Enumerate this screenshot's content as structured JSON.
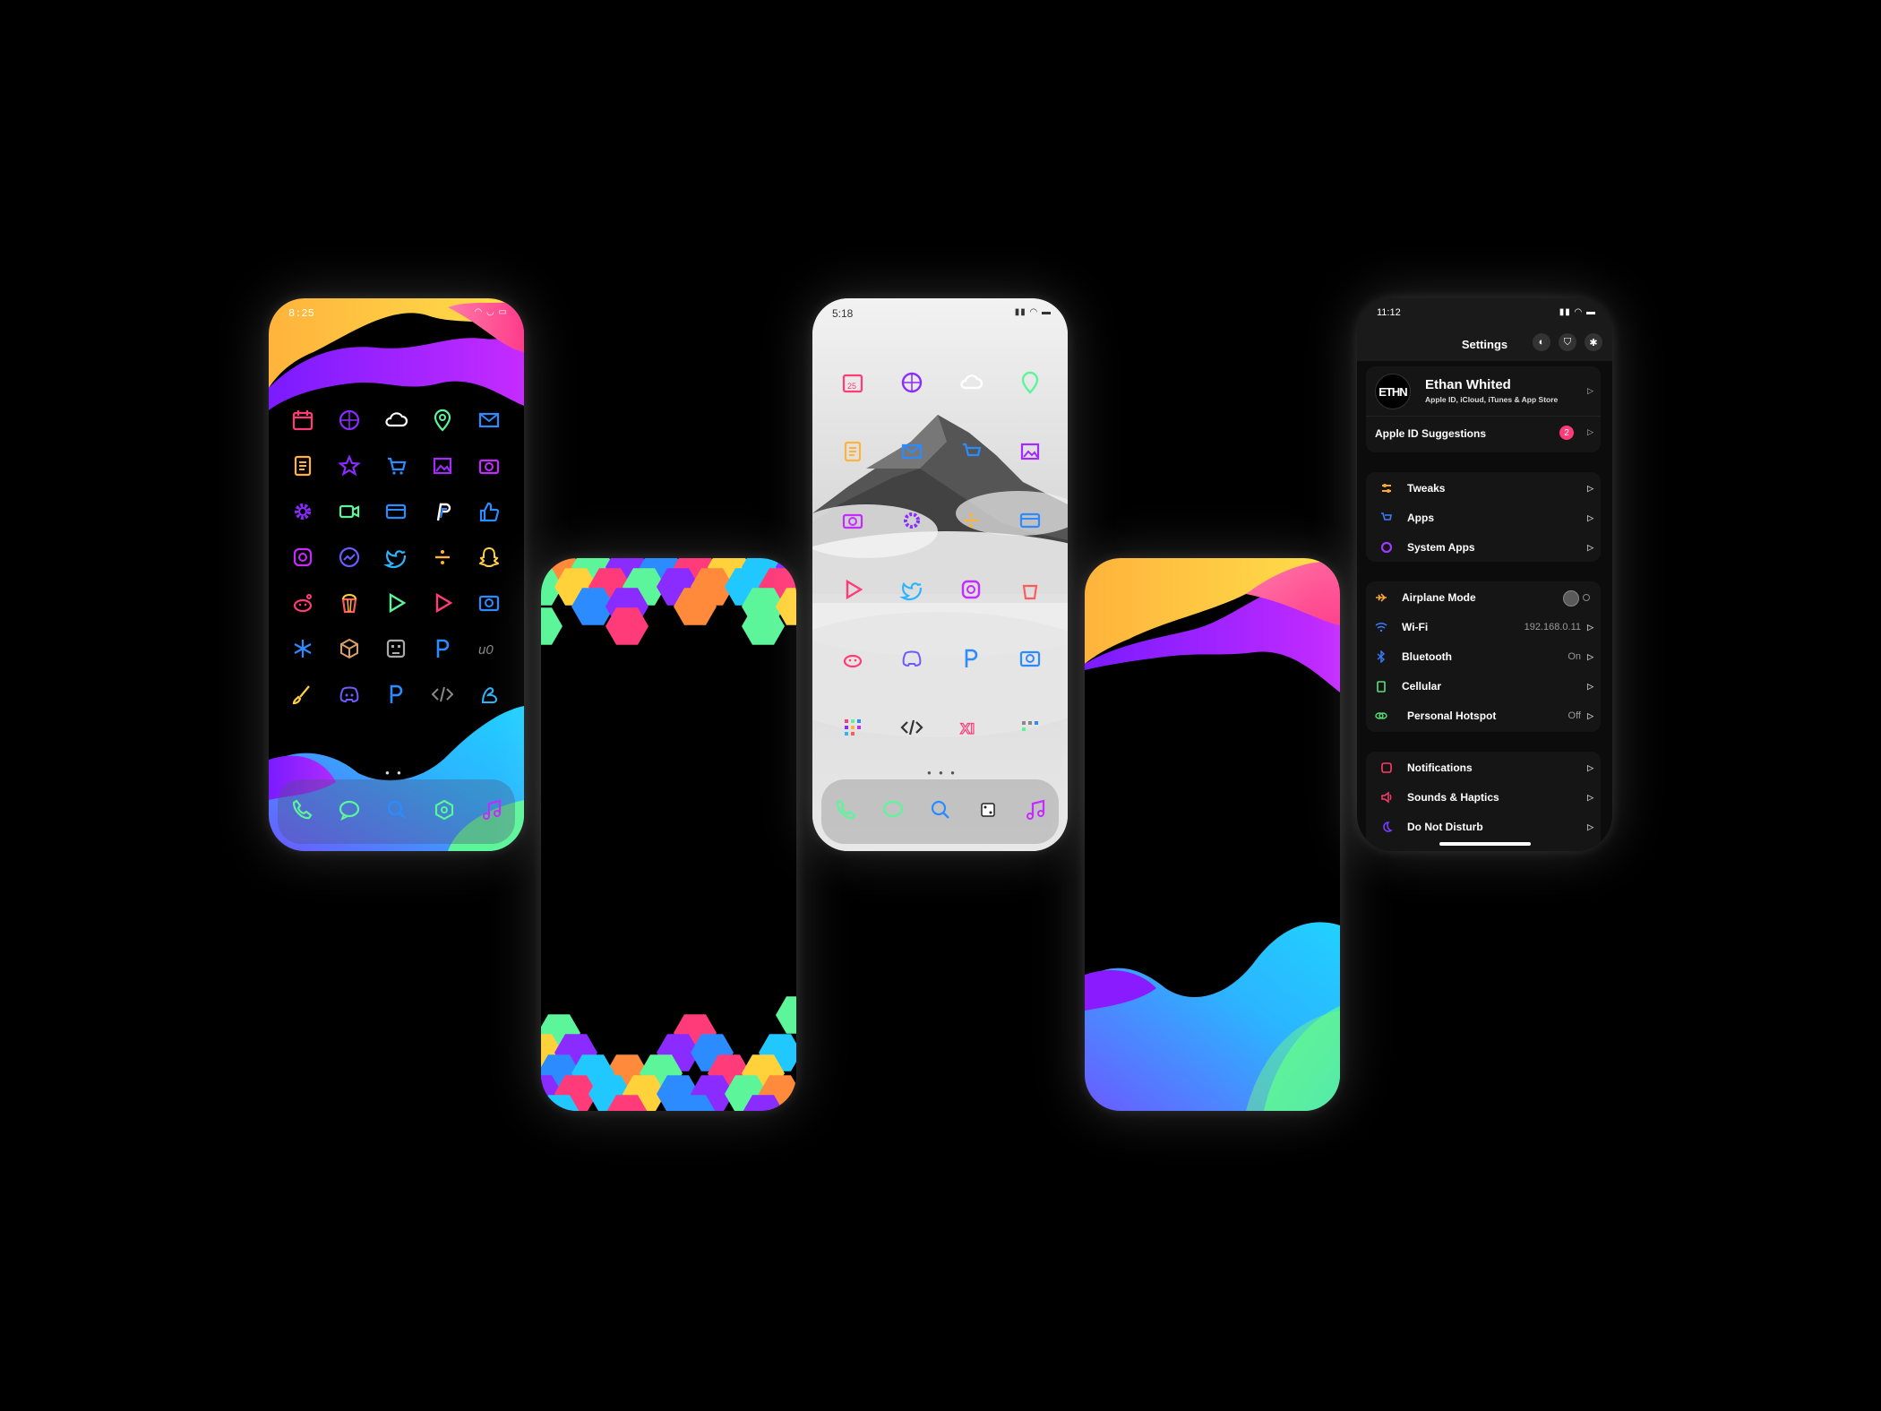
{
  "phone1": {
    "time": "8:25"
  },
  "phone3": {
    "time": "5:18"
  },
  "phone5": {
    "time": "11:12",
    "title": "Settings",
    "profile": {
      "logo": "ETHN",
      "name": "Ethan Whited",
      "subtitle": "Apple ID, iCloud, iTunes & App Store"
    },
    "suggestions": {
      "label": "Apple ID Suggestions",
      "badge": "2"
    },
    "group2": [
      {
        "label": "Tweaks",
        "icon": "tweaks-icon",
        "color": "#f7a93b"
      },
      {
        "label": "Apps",
        "icon": "apps-icon",
        "color": "#3b7dff"
      },
      {
        "label": "System Apps",
        "icon": "system-apps-icon",
        "color": "#9a3bff"
      }
    ],
    "group3": [
      {
        "label": "Airplane Mode",
        "value": "",
        "icon": "airplane-icon",
        "color": "#f7a93b"
      },
      {
        "label": "Wi-Fi",
        "value": "192.168.0.11",
        "icon": "wifi-icon",
        "color": "#3b7dff"
      },
      {
        "label": "Bluetooth",
        "value": "On",
        "icon": "bluetooth-icon",
        "color": "#3b7dff"
      },
      {
        "label": "Cellular",
        "value": "",
        "icon": "cellular-icon",
        "color": "#57e07a"
      },
      {
        "label": "Personal Hotspot",
        "value": "Off",
        "icon": "hotspot-icon",
        "color": "#57e07a"
      }
    ],
    "group4": [
      {
        "label": "Notifications",
        "icon": "notifications-icon",
        "color": "#ff3b6b"
      },
      {
        "label": "Sounds & Haptics",
        "icon": "sounds-icon",
        "color": "#ff3b6b"
      },
      {
        "label": "Do Not Disturb",
        "icon": "moon-icon",
        "color": "#7a3bff"
      }
    ]
  },
  "colors": {
    "pink": "#ff3b7a",
    "purple": "#8a2bff",
    "blue": "#2b8bff",
    "cyan": "#21c8ff",
    "green": "#5df59a",
    "yellow": "#ffd23b",
    "orange": "#ff8a3b"
  }
}
